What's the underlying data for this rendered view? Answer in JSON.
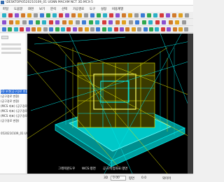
{
  "window": {
    "title": "\\DESKTOP\\0520210109_01 UGNN MACAM NCT 3D.MCX-5"
  },
  "menu": [
    {
      "label": "파일"
    },
    {
      "label": "도움말"
    },
    {
      "label": "화면"
    },
    {
      "label": "보기"
    },
    {
      "label": "분석"
    },
    {
      "label": "선택"
    },
    {
      "label": "가공경로"
    },
    {
      "label": "도구"
    },
    {
      "label": "설정"
    },
    {
      "label": "비용계열"
    }
  ],
  "log": {
    "lines": [
      "2D 포켓(공구경로 변환)",
      "(공구경로 변환)",
      "(공구경로 변환)",
      "(MCS 좌표) (공구경로)",
      "(MCS 좌표) (공구경로)",
      "(MCS 좌표) (공구경로)",
      "(공구경로 변환)"
    ],
    "file_line": "0520210109_01 UGNN M"
  },
  "viewport": {
    "labels": [
      "그래픽윈도우",
      "WCS:평면",
      "공구/작업좌표:평면"
    ]
  },
  "status": {
    "label_3d": "3D",
    "value1": "0.00",
    "plane_label": "평면",
    "value2": "0.0",
    "mode_label": "와이어"
  },
  "colors": {
    "viewport_bg": "#000000",
    "toolpath_cyan": "#00e5e5",
    "toolpath_yellow": "#e8e800",
    "selection_blue": "#2a6dd8"
  }
}
